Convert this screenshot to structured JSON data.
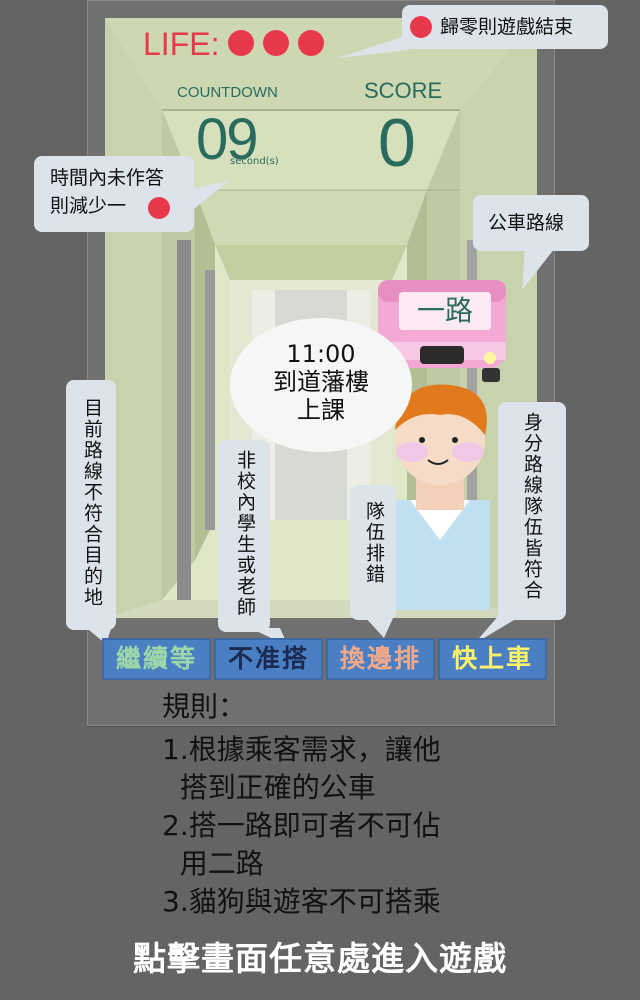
{
  "hud": {
    "life_label": "LIFE:",
    "lives": 3,
    "countdown_label": "COUNTDOWN",
    "countdown_value": "09",
    "countdown_unit": "second(s)",
    "score_label": "SCORE",
    "score_value": "0"
  },
  "colors": {
    "life_red": "#e8394b",
    "hud_teal": "#2a6b5e",
    "button_blue": "#4a7fc4",
    "bus_pink": "#f2a9d3"
  },
  "tips": {
    "life_zero": "歸零則遊戲結束",
    "time_line1": "時間內未作答",
    "time_line2": "則減少一",
    "bus_route": "公車路線",
    "destination_mismatch": "目前路線不符合目的地",
    "non_campus": "非校內學生或老師",
    "wrong_queue": "隊伍排錯",
    "all_match": "身分路線隊伍皆符合"
  },
  "bus": {
    "route_label": "一路"
  },
  "passenger": {
    "thought_time": "11:00",
    "thought_line2": "到道藩樓",
    "thought_line3": "上課"
  },
  "buttons": [
    {
      "label": "繼續等",
      "color": "#9dd6a8"
    },
    {
      "label": "不准搭",
      "color": "#1c2a52"
    },
    {
      "label": "換邊排",
      "color": "#f0a98a"
    },
    {
      "label": "快上車",
      "color": "#fff36b"
    }
  ],
  "rules": {
    "title": "規則：",
    "line1": "1.根據乘客需求，讓他",
    "line1b": "  搭到正確的公車",
    "line2": "2.搭一路即可者不可佔",
    "line2b": "  用二路",
    "line3": "3.貓狗與遊客不可搭乘"
  },
  "start_prompt": "點擊畫面任意處進入遊戲"
}
